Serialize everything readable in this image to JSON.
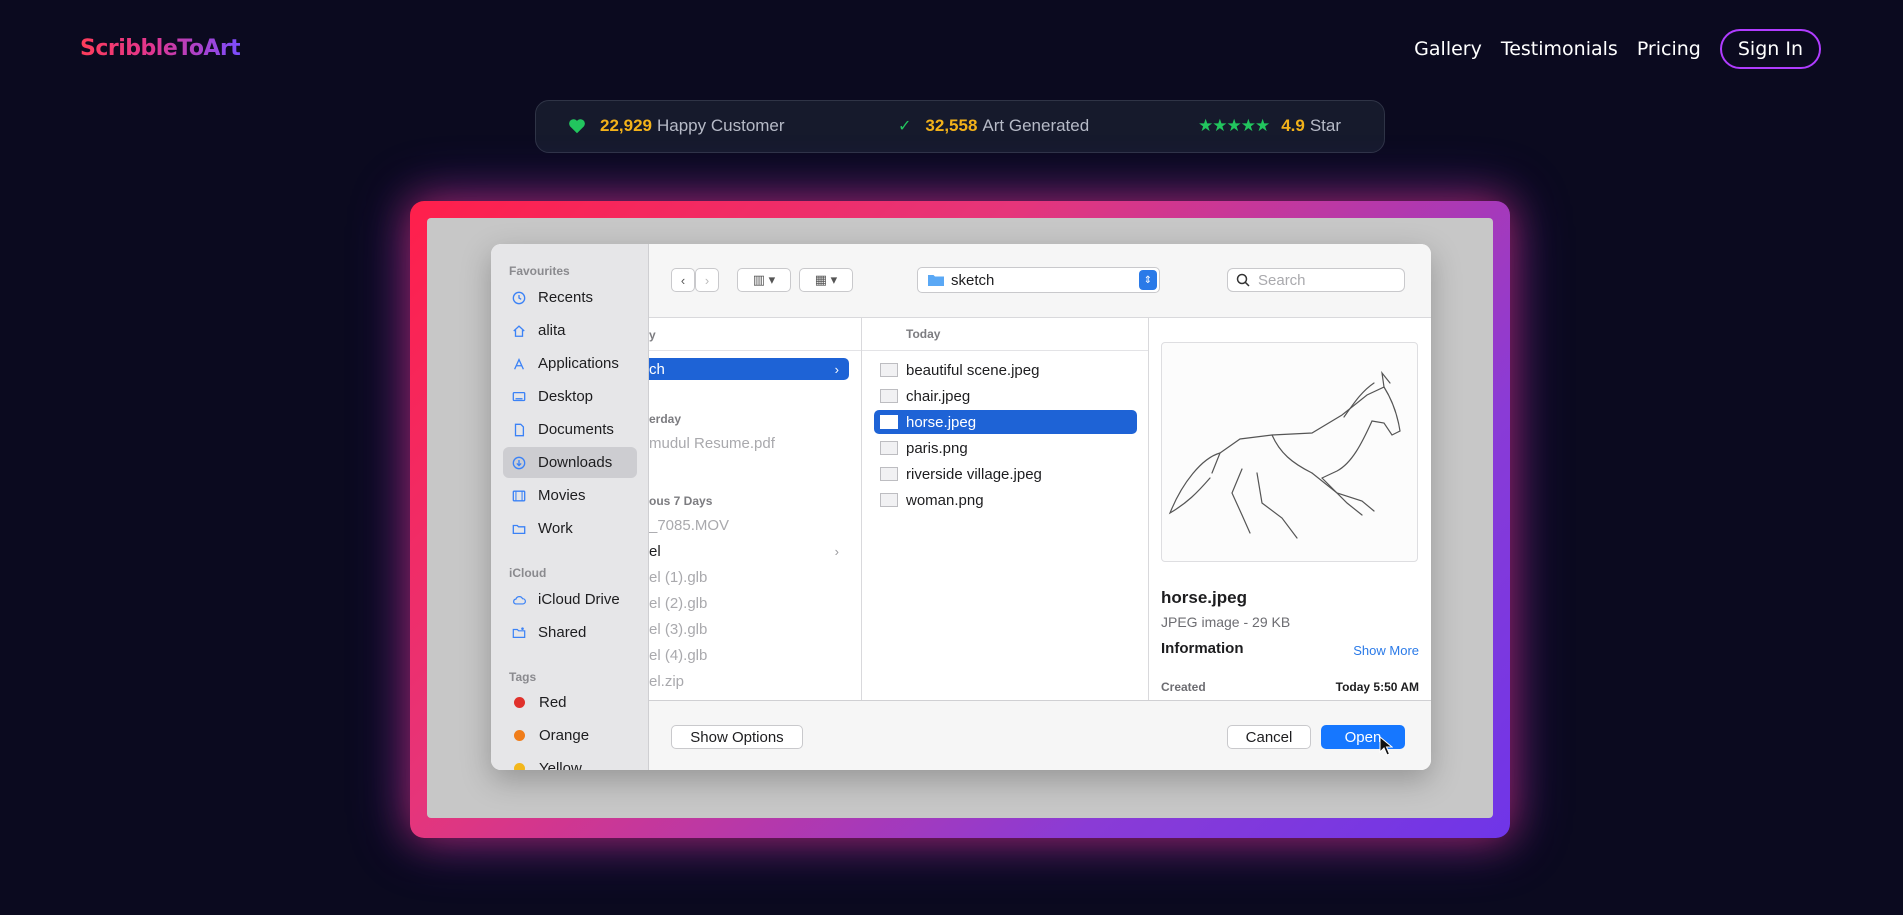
{
  "brand": {
    "logo": "ScribbleToArt"
  },
  "nav": {
    "links": [
      "Gallery",
      "Testimonials",
      "Pricing"
    ],
    "sign_in": "Sign In"
  },
  "stats": [
    {
      "icon": "heart-icon",
      "value": "22,929",
      "label": "Happy Customer"
    },
    {
      "icon": "check-icon",
      "value": "32,558",
      "label": "Art Generated"
    },
    {
      "icon": "stars-icon",
      "value": "4.9",
      "label": "Star",
      "rating": 5
    }
  ],
  "colors": {
    "accent_start": "#ff1f4b",
    "accent_end": "#6f35e8",
    "highlight": "#f3b21a",
    "success": "#22c55e",
    "mac_blue": "#1e63d6"
  },
  "dialog": {
    "sidebar": {
      "favourites_head": "Favourites",
      "favourites": [
        {
          "label": "Recents",
          "icon": "clock-icon"
        },
        {
          "label": "alita",
          "icon": "home-icon"
        },
        {
          "label": "Applications",
          "icon": "apps-icon"
        },
        {
          "label": "Desktop",
          "icon": "desktop-icon"
        },
        {
          "label": "Documents",
          "icon": "document-icon"
        },
        {
          "label": "Downloads",
          "icon": "download-icon",
          "active": true
        },
        {
          "label": "Movies",
          "icon": "film-icon"
        },
        {
          "label": "Work",
          "icon": "folder-icon"
        }
      ],
      "icloud_head": "iCloud",
      "icloud": [
        {
          "label": "iCloud Drive",
          "icon": "cloud-icon"
        },
        {
          "label": "Shared",
          "icon": "shared-folder-icon"
        }
      ],
      "tags_head": "Tags",
      "tags": [
        {
          "label": "Red",
          "color": "#e0312b"
        },
        {
          "label": "Orange",
          "color": "#f07d1a"
        },
        {
          "label": "Yellow",
          "color": "#f2b71c"
        }
      ]
    },
    "toolbar": {
      "folder": "sketch",
      "search_placeholder": "Search"
    },
    "column1": {
      "head_partial": "y",
      "selected": "ch",
      "yesterday": "erday",
      "resume": "mudul Resume.pdf",
      "prev7": "ous 7 Days",
      "items": [
        "_7085.MOV",
        "el",
        "el (1).glb",
        "el (2).glb",
        "el (3).glb",
        "el (4).glb",
        "el.zip"
      ]
    },
    "column2": {
      "head": "Today",
      "files": [
        "beautiful scene.jpeg",
        "chair.jpeg",
        "horse.jpeg",
        "paris.png",
        "riverside village.jpeg",
        "woman.png"
      ],
      "selected_index": 2
    },
    "preview": {
      "name": "horse.jpeg",
      "type": "JPEG image - 29 KB",
      "info": "Information",
      "show_more": "Show More",
      "created_label": "Created",
      "created_value": "Today 5:50 AM"
    },
    "footer": {
      "show_options": "Show Options",
      "cancel": "Cancel",
      "open": "Open"
    }
  }
}
